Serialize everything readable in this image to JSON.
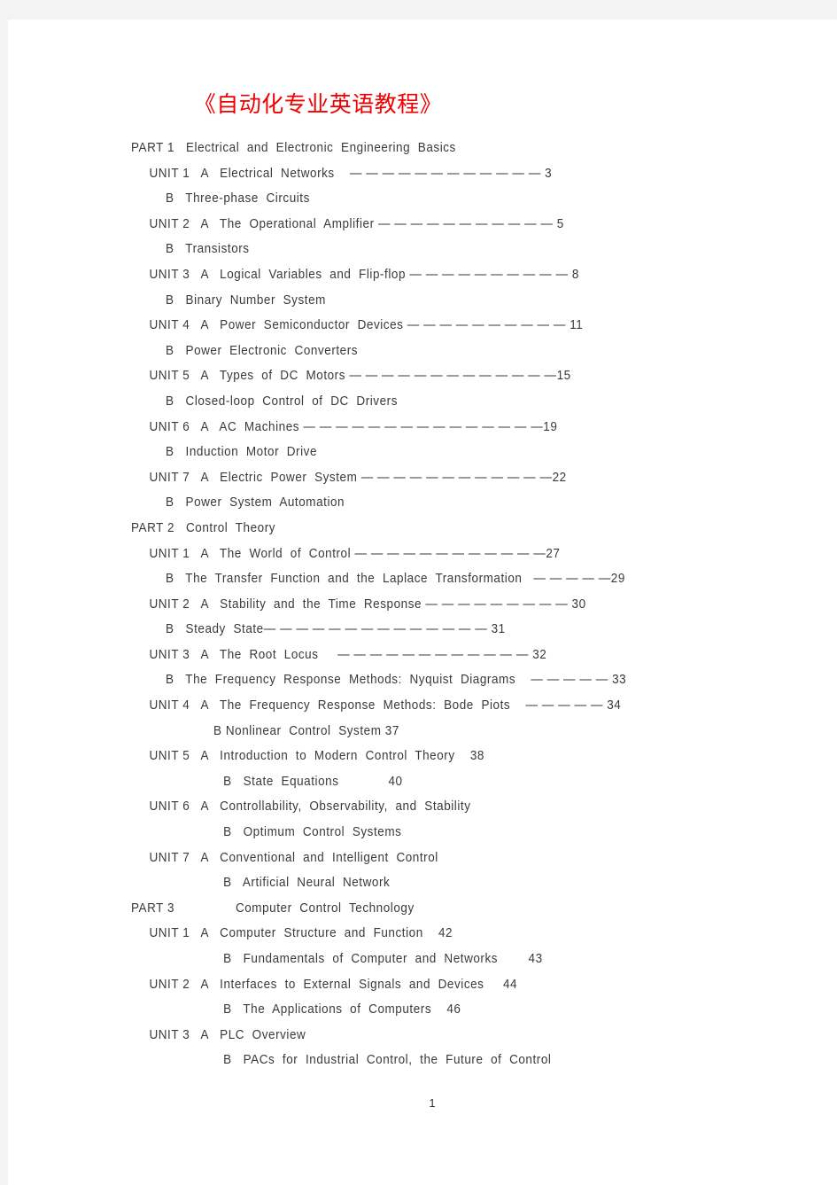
{
  "document": {
    "title": "《自动化专业英语教程》",
    "title_color": "#f00000",
    "page_number": "1",
    "text_color": "#3a3a3a",
    "background_color": "#f3f3f3",
    "page_color": "#ffffff"
  },
  "toc": {
    "lines": [
      {
        "indent": "part",
        "label": "PART 1   Electrical  and  Electronic  Engineering  Basics",
        "leader": "",
        "page": ""
      },
      {
        "indent": "unit",
        "label": "UNIT 1   A   Electrical  Networks",
        "leader": "    — — — — — — — — — — — — ",
        "page": "3"
      },
      {
        "indent": "sub",
        "label": "B   Three-phase  Circuits",
        "leader": "",
        "page": ""
      },
      {
        "indent": "unit",
        "label": "UNIT 2   A   The  Operational  Amplifier ",
        "leader": "— — — — — — — — — — — ",
        "page": "5"
      },
      {
        "indent": "sub",
        "label": "B   Transistors",
        "leader": "",
        "page": ""
      },
      {
        "indent": "unit",
        "label": "UNIT 3   A   Logical  Variables  and  Flip-flop ",
        "leader": "— — — — — — — — — — ",
        "page": "8"
      },
      {
        "indent": "sub",
        "label": "B   Binary  Number  System",
        "leader": "",
        "page": ""
      },
      {
        "indent": "unit",
        "label": "UNIT 4   A   Power  Semiconductor  Devices ",
        "leader": "— — — — — — — — — — ",
        "page": "11"
      },
      {
        "indent": "sub",
        "label": "B   Power  Electronic  Converters",
        "leader": "",
        "page": ""
      },
      {
        "indent": "unit",
        "label": "UNIT 5   A   Types  of  DC  Motors ",
        "leader": "— — — — — — — — — — — — —",
        "page": "15"
      },
      {
        "indent": "sub",
        "label": "B   Closed-loop  Control  of  DC  Drivers",
        "leader": "",
        "page": ""
      },
      {
        "indent": "unit",
        "label": "UNIT 6   A   AC  Machines ",
        "leader": "— — — — — — — — — — — — — — —",
        "page": "19"
      },
      {
        "indent": "sub",
        "label": "B   Induction  Motor  Drive",
        "leader": "",
        "page": ""
      },
      {
        "indent": "unit",
        "label": "UNIT 7   A   Electric  Power  System ",
        "leader": "— — — — — — — — — — — —",
        "page": "22"
      },
      {
        "indent": "sub",
        "label": "B   Power  System  Automation",
        "leader": "",
        "page": ""
      },
      {
        "indent": "part",
        "label": "PART 2   Control  Theory",
        "leader": "",
        "page": ""
      },
      {
        "indent": "unit",
        "label": "UNIT 1   A   The  World  of  Control ",
        "leader": "— — — — — — — — — — — —",
        "page": "27"
      },
      {
        "indent": "sub",
        "label": "B   The  Transfer  Function  and  the  Laplace  Transformation ",
        "leader": "  — — — — —",
        "page": "29"
      },
      {
        "indent": "unit",
        "label": "UNIT 2   A   Stability  and  the  Time  Response ",
        "leader": "— — — — — — — — — ",
        "page": "30"
      },
      {
        "indent": "sub",
        "label": "B   Steady  State",
        "leader": "— — — — — — — — — — — — — — ",
        "page": "31"
      },
      {
        "indent": "unit",
        "label": "UNIT 3   A   The  Root  Locus ",
        "leader": "    — — — — — — — — — — — — ",
        "page": "32"
      },
      {
        "indent": "sub",
        "label": "B   The  Frequency  Response  Methods:  Nyquist  Diagrams ",
        "leader": "   — — — — — ",
        "page": "33"
      },
      {
        "indent": "unit",
        "label": "UNIT 4   A   The  Frequency  Response  Methods:  Bode  Piots ",
        "leader": "   — — — — — ",
        "page": "34"
      },
      {
        "indent": "sub2",
        "label": "B Nonlinear  Control  System 37",
        "leader": "",
        "page": ""
      },
      {
        "indent": "unit",
        "label": "UNIT 5   A   Introduction  to  Modern  Control  Theory    38",
        "leader": "",
        "page": ""
      },
      {
        "indent": "sub3",
        "label": "B   State  Equations             40",
        "leader": "",
        "page": ""
      },
      {
        "indent": "unit",
        "label": "UNIT 6   A   Controllability,  Observability,  and  Stability",
        "leader": "",
        "page": ""
      },
      {
        "indent": "sub3",
        "label": "B   Optimum  Control  Systems",
        "leader": "",
        "page": ""
      },
      {
        "indent": "unit",
        "label": "UNIT 7   A   Conventional  and  Intelligent  Control",
        "leader": "",
        "page": ""
      },
      {
        "indent": "sub3",
        "label": "B   Artificial  Neural  Network",
        "leader": "",
        "page": ""
      },
      {
        "indent": "part",
        "label": "PART 3                Computer  Control  Technology",
        "leader": "",
        "page": ""
      },
      {
        "indent": "unit",
        "label": "UNIT 1   A   Computer  Structure  and  Function    42",
        "leader": "",
        "page": ""
      },
      {
        "indent": "sub3",
        "label": "B   Fundamentals  of  Computer  and  Networks        43",
        "leader": "",
        "page": ""
      },
      {
        "indent": "unit",
        "label": "UNIT 2   A   Interfaces  to  External  Signals  and  Devices     44",
        "leader": "",
        "page": ""
      },
      {
        "indent": "sub3",
        "label": "B   The  Applications  of  Computers    46",
        "leader": "",
        "page": ""
      },
      {
        "indent": "unit",
        "label": "UNIT 3   A   PLC  Overview",
        "leader": "",
        "page": ""
      },
      {
        "indent": "sub3",
        "label": "B   PACs  for  Industrial  Control,  the  Future  of  Control",
        "leader": "",
        "page": ""
      }
    ]
  }
}
